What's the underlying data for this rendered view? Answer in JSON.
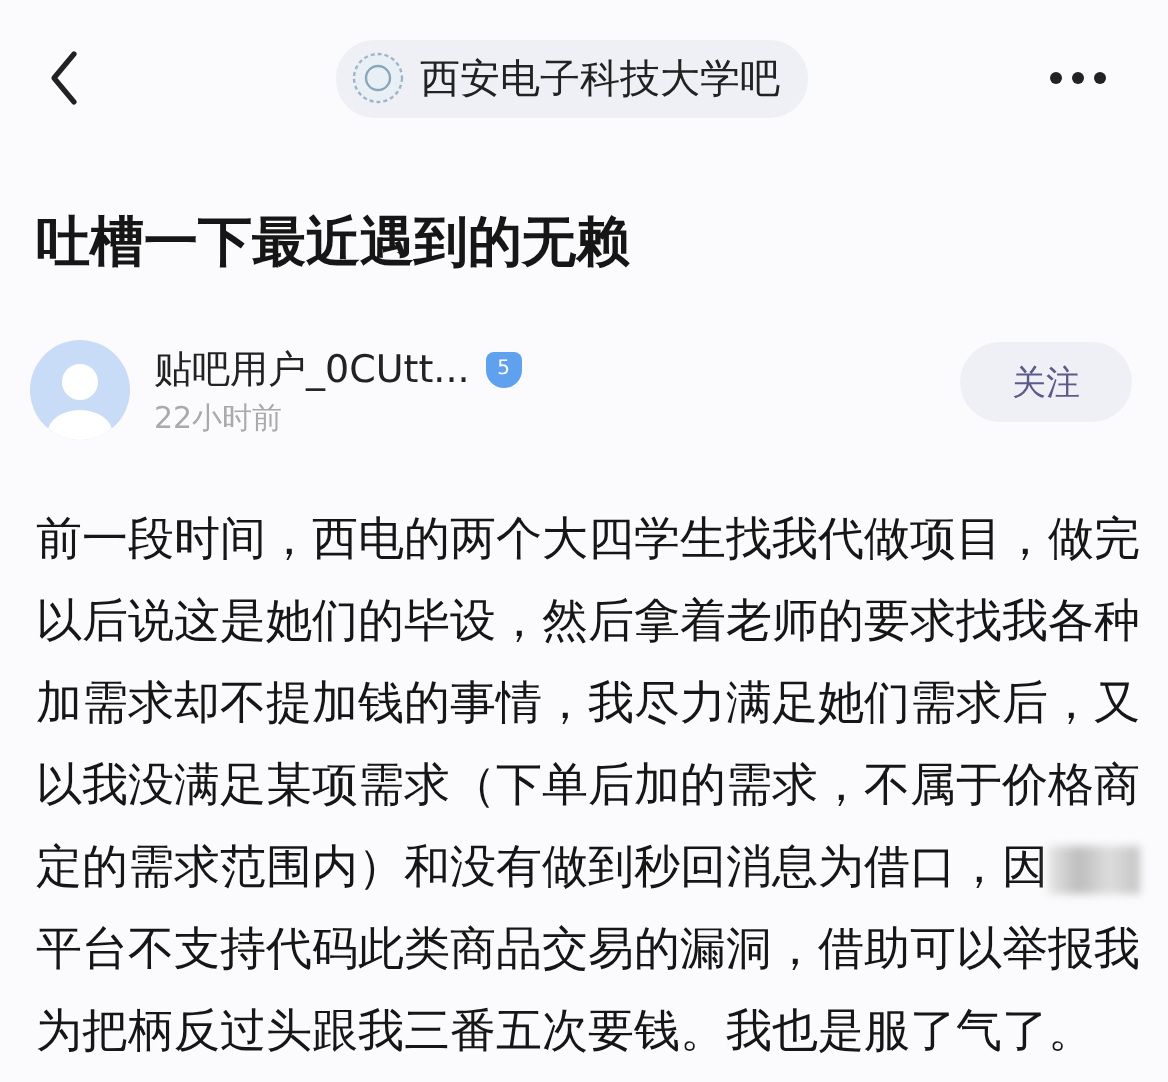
{
  "header": {
    "forum_name": "西安电子科技大学吧"
  },
  "post": {
    "title": "吐槽一下最近遇到的无赖",
    "author": {
      "name": "贴吧用户_0CUtt...",
      "level_badge": "5",
      "time": "22小时前"
    },
    "follow_button": "关注",
    "body_lines": [
      {
        "text": "前一段时间，西电的两个大四学生找我代做项目，做完",
        "redacted": false
      },
      {
        "text": "以后说这是她们的毕设，然后拿着老师的要求找我各种",
        "redacted": false
      },
      {
        "text": "加需求却不提加钱的事情，我尽力满足她们需求后，又",
        "redacted": false
      },
      {
        "text": "以我没满足某项需求（下单后加的需求，不属于价格商",
        "redacted": false
      },
      {
        "text": "定的需求范围内）和没有做到秒回消息为借口，因",
        "redacted": true
      },
      {
        "text": "平台不支持代码此类商品交易的漏洞，借助可以举报我",
        "redacted": false
      },
      {
        "text": "为把柄反过头跟我三番五次要钱。我也是服了气了。",
        "redacted": false
      }
    ]
  }
}
